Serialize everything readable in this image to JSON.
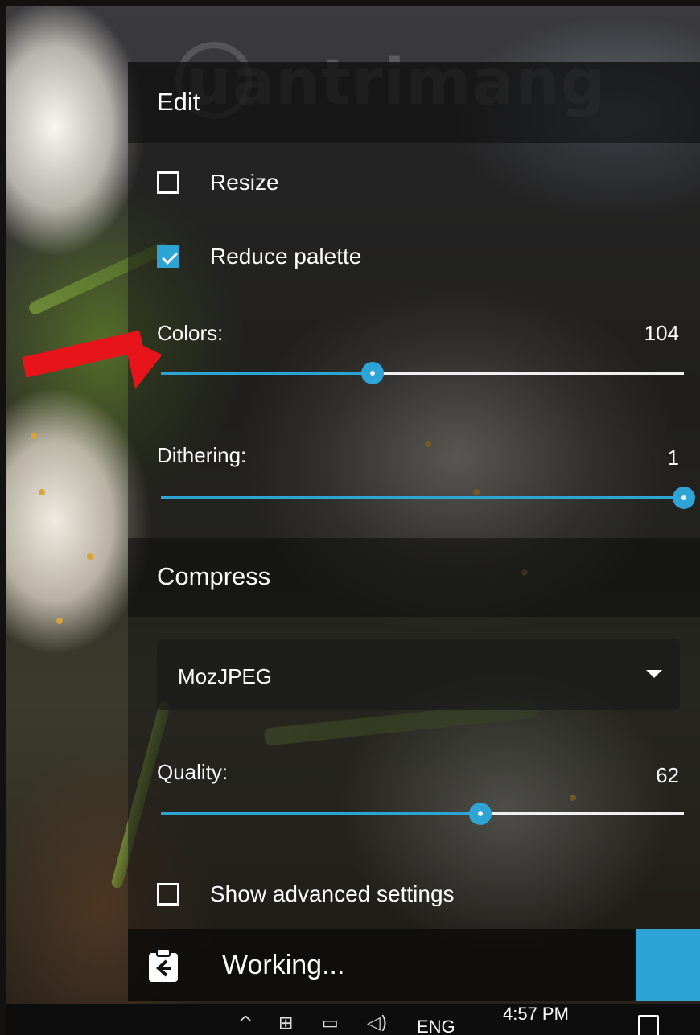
{
  "watermark": "uantrimang",
  "edit": {
    "title": "Edit",
    "resize": {
      "label": "Resize",
      "checked": false
    },
    "reduce_palette": {
      "label": "Reduce palette",
      "checked": true
    },
    "colors": {
      "label": "Colors:",
      "value": "104",
      "fraction": 0.405
    },
    "dithering": {
      "label": "Dithering:",
      "value": "1",
      "fraction": 1.0
    }
  },
  "compress": {
    "title": "Compress",
    "method": {
      "selected": "MozJPEG",
      "icon": "chevron-down-icon"
    },
    "quality": {
      "label": "Quality:",
      "value": "62",
      "fraction": 0.61
    },
    "advanced": {
      "label": "Show advanced settings",
      "checked": false
    }
  },
  "status": {
    "text": "Working...",
    "icon": "clipboard-back-icon"
  },
  "taskbar": {
    "language": "ENG",
    "time": "4:57 PM"
  },
  "colors": {
    "accent": "#2ea3d6",
    "arrow": "#e8141b"
  }
}
